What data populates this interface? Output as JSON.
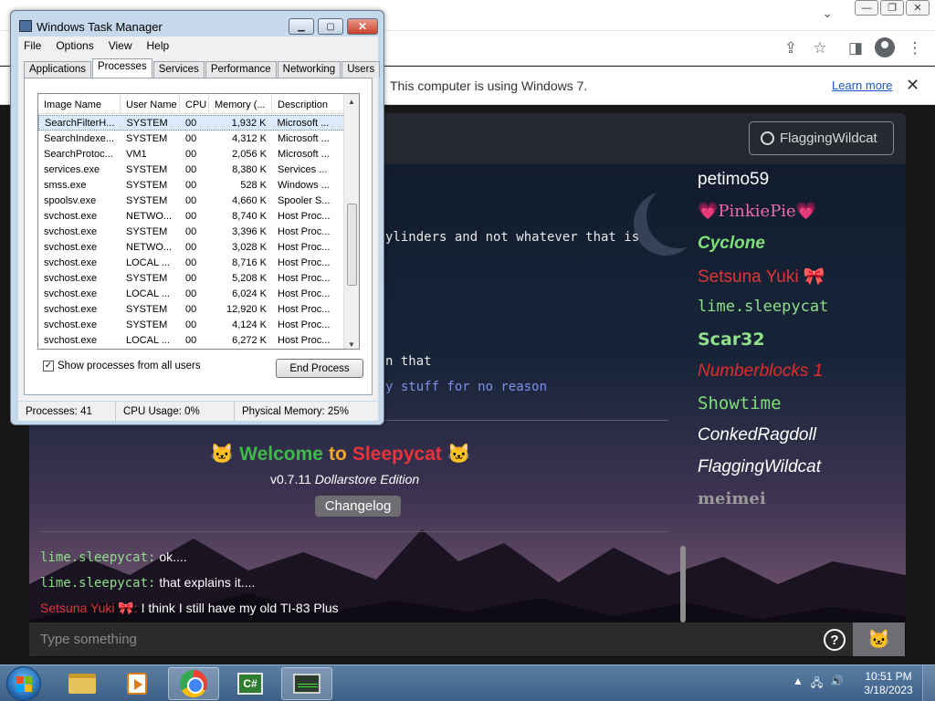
{
  "browser": {
    "window_controls": [
      "—",
      "❐",
      "✕"
    ],
    "chevron": "⌄",
    "toolbar_icons": [
      "share-icon",
      "star-icon",
      "sidebar-icon",
      "profile-icon",
      "menu-icon"
    ],
    "infobar": {
      "message": "This computer is using Windows 7.",
      "learn_more": "Learn more",
      "close": "✕"
    }
  },
  "sleepycat": {
    "user_button": "FlaggingWildcat",
    "chat_fragments": [
      "ylinders and not whatever that is",
      "n that",
      "y stuff for no reason"
    ],
    "welcome": {
      "cat_left": "🐱",
      "words": [
        {
          "text": "Welcome",
          "color": "#3fb94a"
        },
        {
          "text": "to",
          "color": "#f0a830"
        },
        {
          "text": "Sleepycat",
          "color": "#e8333a"
        }
      ],
      "cat_right": "🐱"
    },
    "version_prefix": "v0.7.11 ",
    "version_edition": "Dollarstore Edition",
    "changelog": "Changelog",
    "online_users": [
      {
        "name": "petimo59",
        "color": "#ffffff"
      },
      {
        "name": "💗PinkiePie💗",
        "color": "#f06aa8"
      },
      {
        "name": "Cyclone",
        "color": "#7fe07a"
      },
      {
        "name": "Setsuna Yuki 🎀",
        "color": "#e23636"
      },
      {
        "name": "lime.sleepycat",
        "color": "#8fe08a"
      },
      {
        "name": "Scar32",
        "color": "#8fe08a"
      },
      {
        "name": "Numberblocks 1",
        "color": "#e22b2b"
      },
      {
        "name": "Showtime",
        "color": "#7fe07a"
      },
      {
        "name": "ConkedRagdoll",
        "color": "#ffffff"
      },
      {
        "name": "FlaggingWildcat",
        "color": "#ffffff"
      },
      {
        "name": "meimei",
        "color": "#9a9a9a"
      }
    ],
    "messages": [
      {
        "user": "lime.sleepycat:",
        "text": " ok....",
        "color": "#8fe08a"
      },
      {
        "user": "lime.sleepycat:",
        "text": " that explains it....",
        "color": "#8fe08a"
      },
      {
        "user": "Setsuna Yuki 🎀:",
        "text": " I think I still have my old TI-83 Plus",
        "color": "#e23636"
      }
    ],
    "input_placeholder": "Type something",
    "help": "?",
    "send": "🐱"
  },
  "task_manager": {
    "title": "Windows Task Manager",
    "title_buttons": [
      "▁",
      "▢",
      "✕"
    ],
    "menu": [
      "File",
      "Options",
      "View",
      "Help"
    ],
    "tabs": [
      "Applications",
      "Processes",
      "Services",
      "Performance",
      "Networking",
      "Users"
    ],
    "active_tab": "Processes",
    "columns": [
      "Image Name",
      "User Name",
      "CPU",
      "Memory (...",
      "Description"
    ],
    "rows": [
      [
        "SearchFilterH...",
        "SYSTEM",
        "00",
        "1,932 K",
        "Microsoft ..."
      ],
      [
        "SearchIndexe...",
        "SYSTEM",
        "00",
        "4,312 K",
        "Microsoft ..."
      ],
      [
        "SearchProtoc...",
        "VM1",
        "00",
        "2,056 K",
        "Microsoft ..."
      ],
      [
        "services.exe",
        "SYSTEM",
        "00",
        "8,380 K",
        "Services ..."
      ],
      [
        "smss.exe",
        "SYSTEM",
        "00",
        "528 K",
        "Windows ..."
      ],
      [
        "spoolsv.exe",
        "SYSTEM",
        "00",
        "4,660 K",
        "Spooler S..."
      ],
      [
        "svchost.exe",
        "NETWO...",
        "00",
        "8,740 K",
        "Host Proc..."
      ],
      [
        "svchost.exe",
        "SYSTEM",
        "00",
        "3,396 K",
        "Host Proc..."
      ],
      [
        "svchost.exe",
        "NETWO...",
        "00",
        "3,028 K",
        "Host Proc..."
      ],
      [
        "svchost.exe",
        "LOCAL ...",
        "00",
        "8,716 K",
        "Host Proc..."
      ],
      [
        "svchost.exe",
        "SYSTEM",
        "00",
        "5,208 K",
        "Host Proc..."
      ],
      [
        "svchost.exe",
        "LOCAL ...",
        "00",
        "6,024 K",
        "Host Proc..."
      ],
      [
        "svchost.exe",
        "SYSTEM",
        "00",
        "12,920 K",
        "Host Proc..."
      ],
      [
        "svchost.exe",
        "SYSTEM",
        "00",
        "4,124 K",
        "Host Proc..."
      ],
      [
        "svchost.exe",
        "LOCAL ...",
        "00",
        "6,272 K",
        "Host Proc..."
      ]
    ],
    "show_all_label": "Show processes from all users",
    "show_all_checked": "✓",
    "end_process": "End Process",
    "status": [
      "Processes: 41",
      "CPU Usage: 0%",
      "Physical Memory: 25%"
    ]
  },
  "taskbar": {
    "apps": [
      "explorer-icon",
      "media-player-icon",
      "chrome-icon",
      "csharp-icon",
      "task-manager-icon"
    ],
    "csharp_label": "C#",
    "tray": [
      "▲",
      "🖧",
      "🔊"
    ],
    "time": "10:51 PM",
    "date": "3/18/2023"
  }
}
